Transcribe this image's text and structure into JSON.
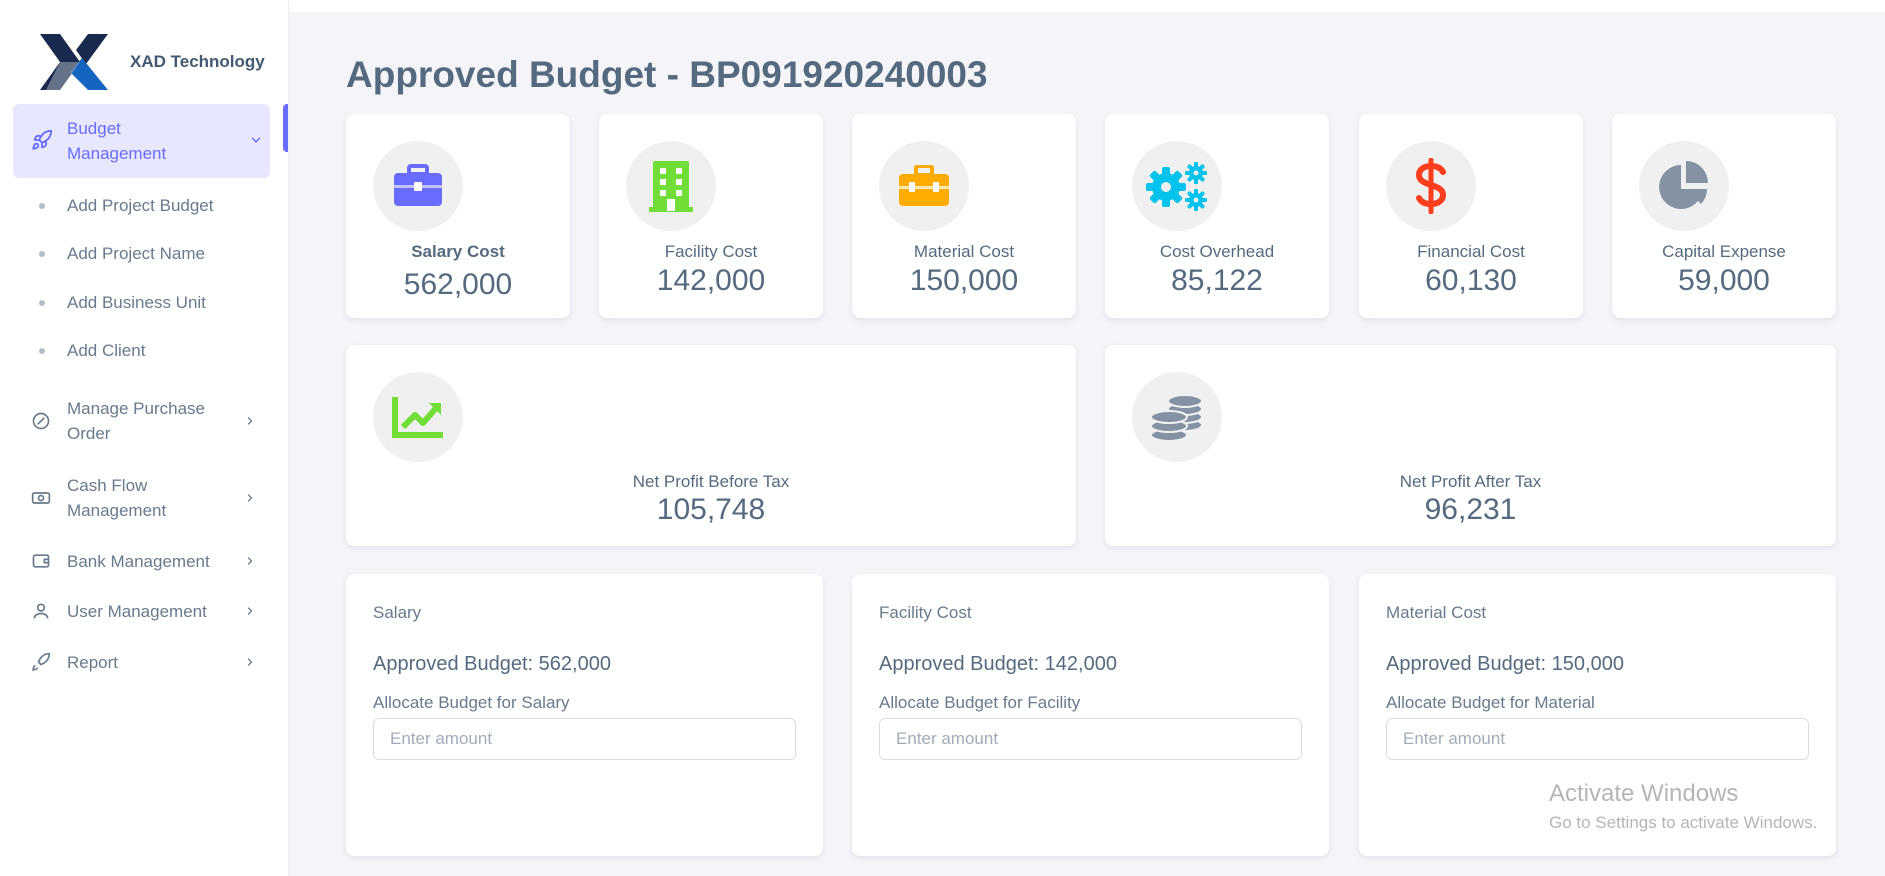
{
  "brand": {
    "name": "XAD Technology"
  },
  "sidebar": {
    "active": {
      "label": "Budget Management"
    },
    "sub_items": [
      {
        "label": "Add Project Budget"
      },
      {
        "label": "Add Project Name"
      },
      {
        "label": "Add Business Unit"
      },
      {
        "label": "Add Client"
      }
    ],
    "items": [
      {
        "label": "Manage Purchase Order",
        "icon": "purchase-order-icon"
      },
      {
        "label": "Cash Flow Management",
        "icon": "cash-icon"
      },
      {
        "label": "Bank Management",
        "icon": "wallet-icon"
      },
      {
        "label": "User Management",
        "icon": "user-icon"
      },
      {
        "label": "Report",
        "icon": "report-icon"
      }
    ]
  },
  "page": {
    "title": "Approved Budget - BP091920240003"
  },
  "stats": [
    {
      "label": "Salary Cost",
      "value": "562,000",
      "icon": "briefcase-icon",
      "color": "#696cff"
    },
    {
      "label": "Facility Cost",
      "value": "142,000",
      "icon": "building-icon",
      "color": "#71dd37"
    },
    {
      "label": "Material Cost",
      "value": "150,000",
      "icon": "toolbox-icon",
      "color": "#ffab00"
    },
    {
      "label": "Cost Overhead",
      "value": "85,122",
      "icon": "gears-icon",
      "color": "#03c3ec"
    },
    {
      "label": "Financial Cost",
      "value": "60,130",
      "icon": "dollar-icon",
      "color": "#ff3e1d"
    },
    {
      "label": "Capital Expense",
      "value": "59,000",
      "icon": "pie-chart-icon",
      "color": "#8592a3"
    }
  ],
  "profit": [
    {
      "label": "Net Profit Before Tax",
      "value": "105,748",
      "icon": "chart-line-icon",
      "color": "#71dd37"
    },
    {
      "label": "Net Profit After Tax",
      "value": "96,231",
      "icon": "coins-icon",
      "color": "#8592a3"
    }
  ],
  "allocations": [
    {
      "title": "Salary",
      "approved": "Approved Budget: 562,000",
      "label": "Allocate Budget for Salary",
      "placeholder": "Enter amount"
    },
    {
      "title": "Facility Cost",
      "approved": "Approved Budget: 142,000",
      "label": "Allocate Budget for Facility",
      "placeholder": "Enter amount"
    },
    {
      "title": "Material Cost",
      "approved": "Approved Budget: 150,000",
      "label": "Allocate Budget for Material",
      "placeholder": "Enter amount"
    }
  ],
  "watermark": {
    "title": "Activate Windows",
    "subtitle": "Go to Settings to activate Windows."
  }
}
